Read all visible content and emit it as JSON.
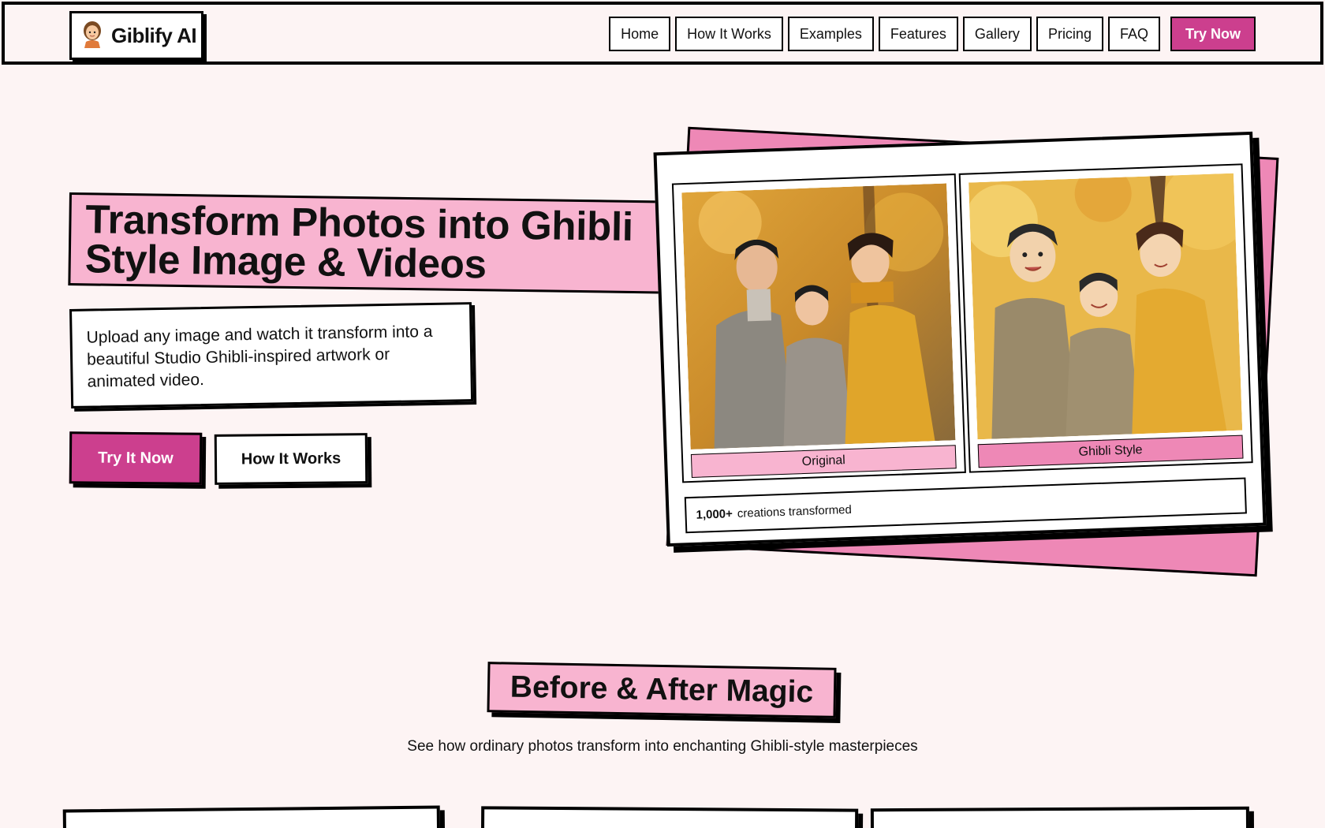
{
  "brand": {
    "name": "Giblify AI",
    "logo_icon": "girl-avatar-icon"
  },
  "nav": {
    "links": [
      "Home",
      "How It Works",
      "Examples",
      "Features",
      "Gallery",
      "Pricing",
      "FAQ"
    ],
    "cta": "Try Now"
  },
  "hero": {
    "title_line1": "Transform Photos into Ghibli",
    "title_line2": "Style Image & Videos",
    "subtitle_line1": "Upload any image and watch it transform into a",
    "subtitle_line2": "beautiful Studio Ghibli-inspired artwork or",
    "subtitle_line3": "animated video.",
    "primary_button": "Try It Now",
    "secondary_button": "How It Works"
  },
  "showcase": {
    "original_label": "Original",
    "ghibli_label": "Ghibli Style",
    "stat_count": "1,000+",
    "stat_text": "creations transformed"
  },
  "before_after": {
    "title": "Before & After Magic",
    "subtitle": "See how ordinary photos transform into enchanting Ghibli-style masterpieces"
  },
  "colors": {
    "background": "#fdf4f4",
    "accent": "#cc3f8e",
    "pink_light": "#f8b4d0",
    "pink_mid": "#ee88b6",
    "border": "#000000"
  }
}
